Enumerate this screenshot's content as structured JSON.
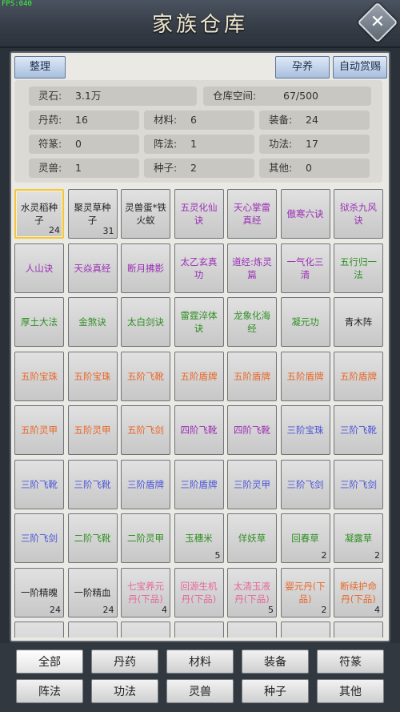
{
  "fps": "FPS:040",
  "title": "家族仓库",
  "toolbar": {
    "organize": "整理",
    "nurture": "孕养",
    "auto_reward": "自动赏赐"
  },
  "stats": {
    "spirit_stone": {
      "label": "灵石:",
      "value": "3.1万"
    },
    "capacity": {
      "label": "仓库空间:",
      "value": "67/500"
    },
    "pills": {
      "label": "丹药:",
      "value": "16"
    },
    "materials": {
      "label": "材料:",
      "value": "6"
    },
    "equipment": {
      "label": "装备:",
      "value": "24"
    },
    "talismans": {
      "label": "符篆:",
      "value": "0"
    },
    "formations": {
      "label": "阵法:",
      "value": "1"
    },
    "techniques": {
      "label": "功法:",
      "value": "17"
    },
    "beasts": {
      "label": "灵兽:",
      "value": "1"
    },
    "seeds": {
      "label": "种子:",
      "value": "2"
    },
    "others": {
      "label": "其他:",
      "value": "0"
    }
  },
  "colors": {
    "purple": "#9b2fb5",
    "green": "#2f8f23",
    "orange": "#e8672a",
    "blue": "#4b55d8",
    "pink": "#e4679a",
    "dark": "#222222"
  },
  "items": [
    {
      "name": "水灵稻种子",
      "count": "24",
      "color": "dark",
      "selected": true
    },
    {
      "name": "聚灵草种子",
      "count": "31",
      "color": "dark"
    },
    {
      "name": "灵兽蛋*铁火蚁",
      "count": "",
      "color": "dark"
    },
    {
      "name": "五灵化仙诀",
      "count": "",
      "color": "purple"
    },
    {
      "name": "天心掌雷真经",
      "count": "",
      "color": "purple"
    },
    {
      "name": "傲寒六诀",
      "count": "",
      "color": "purple"
    },
    {
      "name": "狱杀九风诀",
      "count": "",
      "color": "purple"
    },
    {
      "name": "人山诀",
      "count": "",
      "color": "purple"
    },
    {
      "name": "天焱真经",
      "count": "",
      "color": "purple"
    },
    {
      "name": "断月拂影",
      "count": "",
      "color": "purple"
    },
    {
      "name": "太乙玄真功",
      "count": "",
      "color": "purple"
    },
    {
      "name": "道经:炼灵篇",
      "count": "",
      "color": "purple"
    },
    {
      "name": "一气化三清",
      "count": "",
      "color": "purple"
    },
    {
      "name": "五行归一法",
      "count": "",
      "color": "green"
    },
    {
      "name": "厚土大法",
      "count": "",
      "color": "green"
    },
    {
      "name": "金煞诀",
      "count": "",
      "color": "green"
    },
    {
      "name": "太白剑诀",
      "count": "",
      "color": "green"
    },
    {
      "name": "雷霆淬体诀",
      "count": "",
      "color": "green"
    },
    {
      "name": "龙象化海经",
      "count": "",
      "color": "green"
    },
    {
      "name": "凝元功",
      "count": "",
      "color": "green"
    },
    {
      "name": "青木阵",
      "count": "",
      "color": "dark"
    },
    {
      "name": "五阶宝珠",
      "count": "",
      "color": "orange"
    },
    {
      "name": "五阶宝珠",
      "count": "",
      "color": "orange"
    },
    {
      "name": "五阶飞靴",
      "count": "",
      "color": "orange"
    },
    {
      "name": "五阶盾牌",
      "count": "",
      "color": "orange"
    },
    {
      "name": "五阶盾牌",
      "count": "",
      "color": "orange"
    },
    {
      "name": "五阶盾牌",
      "count": "",
      "color": "orange"
    },
    {
      "name": "五阶盾牌",
      "count": "",
      "color": "orange"
    },
    {
      "name": "五阶灵甲",
      "count": "",
      "color": "orange"
    },
    {
      "name": "五阶灵甲",
      "count": "",
      "color": "orange"
    },
    {
      "name": "五阶飞剑",
      "count": "",
      "color": "orange"
    },
    {
      "name": "四阶飞靴",
      "count": "",
      "color": "purple"
    },
    {
      "name": "四阶飞靴",
      "count": "",
      "color": "purple"
    },
    {
      "name": "三阶宝珠",
      "count": "",
      "color": "blue"
    },
    {
      "name": "三阶飞靴",
      "count": "",
      "color": "blue"
    },
    {
      "name": "三阶飞靴",
      "count": "",
      "color": "blue"
    },
    {
      "name": "三阶飞靴",
      "count": "",
      "color": "blue"
    },
    {
      "name": "三阶盾牌",
      "count": "",
      "color": "blue"
    },
    {
      "name": "三阶盾牌",
      "count": "",
      "color": "blue"
    },
    {
      "name": "三阶灵甲",
      "count": "",
      "color": "blue"
    },
    {
      "name": "三阶飞剑",
      "count": "",
      "color": "blue"
    },
    {
      "name": "三阶飞剑",
      "count": "",
      "color": "blue"
    },
    {
      "name": "三阶飞剑",
      "count": "",
      "color": "blue"
    },
    {
      "name": "二阶飞靴",
      "count": "",
      "color": "green"
    },
    {
      "name": "二阶灵甲",
      "count": "",
      "color": "green"
    },
    {
      "name": "玉穗米",
      "count": "5",
      "color": "green"
    },
    {
      "name": "佯妖草",
      "count": "",
      "color": "green"
    },
    {
      "name": "回春草",
      "count": "2",
      "color": "green"
    },
    {
      "name": "凝露草",
      "count": "2",
      "color": "green"
    },
    {
      "name": "一阶精魄",
      "count": "24",
      "color": "dark"
    },
    {
      "name": "一阶精血",
      "count": "24",
      "color": "dark"
    },
    {
      "name": "七宝养元丹(下品)",
      "count": "4",
      "color": "pink"
    },
    {
      "name": "回源生机丹(下品)",
      "count": "",
      "color": "pink"
    },
    {
      "name": "太清玉液丹(下品)",
      "count": "5",
      "color": "pink"
    },
    {
      "name": "婴元丹(下品)",
      "count": "2",
      "color": "orange"
    },
    {
      "name": "断续护命丹(下品)",
      "count": "4",
      "color": "orange"
    },
    {
      "name": "",
      "count": "",
      "color": "dark"
    },
    {
      "name": "",
      "count": "",
      "color": "dark"
    },
    {
      "name": "",
      "count": "",
      "color": "dark"
    },
    {
      "name": "",
      "count": "",
      "color": "dark"
    },
    {
      "name": "",
      "count": "",
      "color": "dark"
    },
    {
      "name": "",
      "count": "",
      "color": "dark"
    },
    {
      "name": "",
      "count": "",
      "color": "dark"
    }
  ],
  "tabs": [
    "全部",
    "丹药",
    "材料",
    "装备",
    "符篆",
    "阵法",
    "功法",
    "灵兽",
    "种子",
    "其他"
  ]
}
